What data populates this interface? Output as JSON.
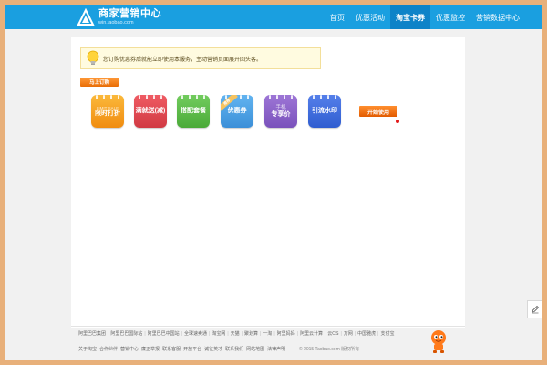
{
  "header": {
    "logo_title": "商家营销中心",
    "logo_sub": "win.taobao.com",
    "nav": [
      {
        "label": "首页",
        "active": false
      },
      {
        "label": "优惠活动",
        "active": false
      },
      {
        "label": "淘宝卡券",
        "active": true
      },
      {
        "label": "优惠监控",
        "active": false
      },
      {
        "label": "营销数据中心",
        "active": false
      }
    ]
  },
  "notice": {
    "text": "您订购优惠券后就能立即使用本服务，主动营销页面展开回头客。"
  },
  "subscribe_label": "马上订购",
  "tools": [
    {
      "small": "LIMIT SALE",
      "label": "限时打折",
      "color": "#f5a623",
      "ribbon": ""
    },
    {
      "small": "",
      "label": "满就送(减)",
      "color": "#e24a52",
      "ribbon": ""
    },
    {
      "small": "",
      "label": "搭配套餐",
      "color": "#5cbc4a",
      "ribbon": ""
    },
    {
      "small": "",
      "label": "优惠券",
      "color": "#4ba2e6",
      "ribbon": "推荐"
    },
    {
      "small": "手机",
      "label": "专享价",
      "color": "#8c63c9",
      "ribbon": ""
    },
    {
      "small": "",
      "label": "引流水印",
      "color": "#3f6fe0",
      "ribbon": ""
    }
  ],
  "start_label": "开始使用",
  "footer": {
    "links": [
      "关于淘宝",
      "合作伙伴",
      "营销中心",
      "廉正举报",
      "联系客服",
      "开放平台",
      "诚征英才",
      "联系我们",
      "网站地图",
      "法律声明"
    ],
    "row1": [
      "阿里巴巴集团",
      "阿里巴巴国际站",
      "阿里巴巴中国站",
      "全球速卖通",
      "淘宝网",
      "天猫",
      "聚划算",
      "一淘",
      "阿里妈妈",
      "阿里云计算",
      "云OS",
      "万网",
      "中国雅虎",
      "支付宝"
    ],
    "copyright": "© 2015 Taobao.com 版权所有"
  },
  "colors": {
    "header": "#1a9fe0",
    "nav_active": "#0e83c8",
    "accent_orange": "#e96d05",
    "frame": "#e8b07a"
  },
  "icons": {
    "logo": "taobao-logo-icon",
    "notice": "lightbulb-icon",
    "side": "edit-pencil-icon",
    "mascot": "mascot-icon"
  }
}
